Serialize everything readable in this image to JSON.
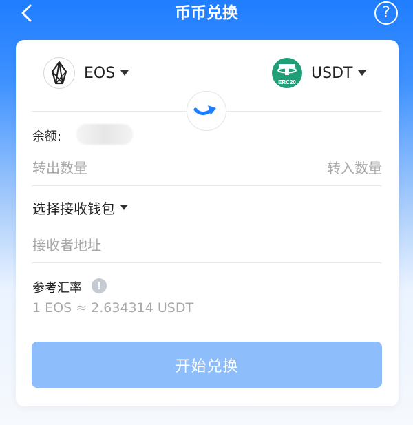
{
  "header": {
    "title": "币币兑换",
    "help_label": "?"
  },
  "from_coin": {
    "name": "EOS",
    "icon": "eos-logo-icon"
  },
  "to_coin": {
    "name": "USDT",
    "badge": "ERC20",
    "icon": "usdt-erc20-logo-icon"
  },
  "balance": {
    "label": "余额:"
  },
  "amount": {
    "out_placeholder": "转出数量",
    "in_placeholder": "转入数量"
  },
  "wallet": {
    "select_label": "选择接收钱包",
    "address_placeholder": "接收者地址"
  },
  "rate": {
    "label": "参考汇率",
    "info_label": "!",
    "value": "1 EOS ≈ 2.634314 USDT"
  },
  "submit": {
    "label": "开始兑换"
  },
  "colors": {
    "header_blue": "#1f7dff",
    "button_disabled": "#8dbdfa",
    "usdt_green": "#1f9e78",
    "swap_arrow": "#1f7dff"
  }
}
